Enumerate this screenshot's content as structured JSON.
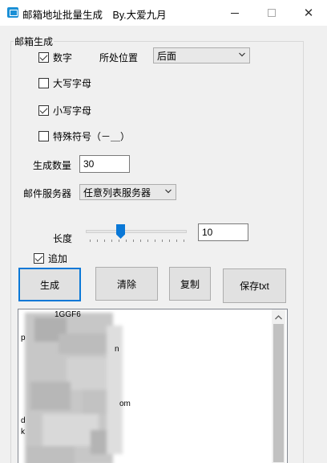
{
  "window": {
    "title": "邮箱地址批量生成　By.大爱九月",
    "minimize_icon": "minimize-icon",
    "maximize_icon": "maximize-icon",
    "close_icon": "close-icon"
  },
  "group": {
    "label": "邮箱生成"
  },
  "options": {
    "digits": {
      "label": "数字",
      "checked": true
    },
    "uppercase": {
      "label": "大写字母",
      "checked": false
    },
    "lowercase": {
      "label": "小写字母",
      "checked": true
    },
    "special": {
      "label": "特殊符号（－＿）",
      "checked": false
    }
  },
  "position": {
    "label": "所处位置",
    "value": "后面"
  },
  "count": {
    "label": "生成数量",
    "value": "30"
  },
  "server": {
    "label": "邮件服务器",
    "value": "任意列表服务器"
  },
  "length": {
    "label": "长度",
    "value": "10",
    "slider_fraction": 0.33
  },
  "append": {
    "label": "追加",
    "checked": true
  },
  "buttons": {
    "generate": "生成",
    "clear": "清除",
    "copy": "复制",
    "save": "保存txt"
  },
  "output": {
    "lines": [
      "1GGF6",
      "p",
      "n",
      "om",
      "d",
      "k"
    ]
  },
  "colors": {
    "accent": "#0a78d7",
    "app_icon": "#1a8fd6"
  }
}
